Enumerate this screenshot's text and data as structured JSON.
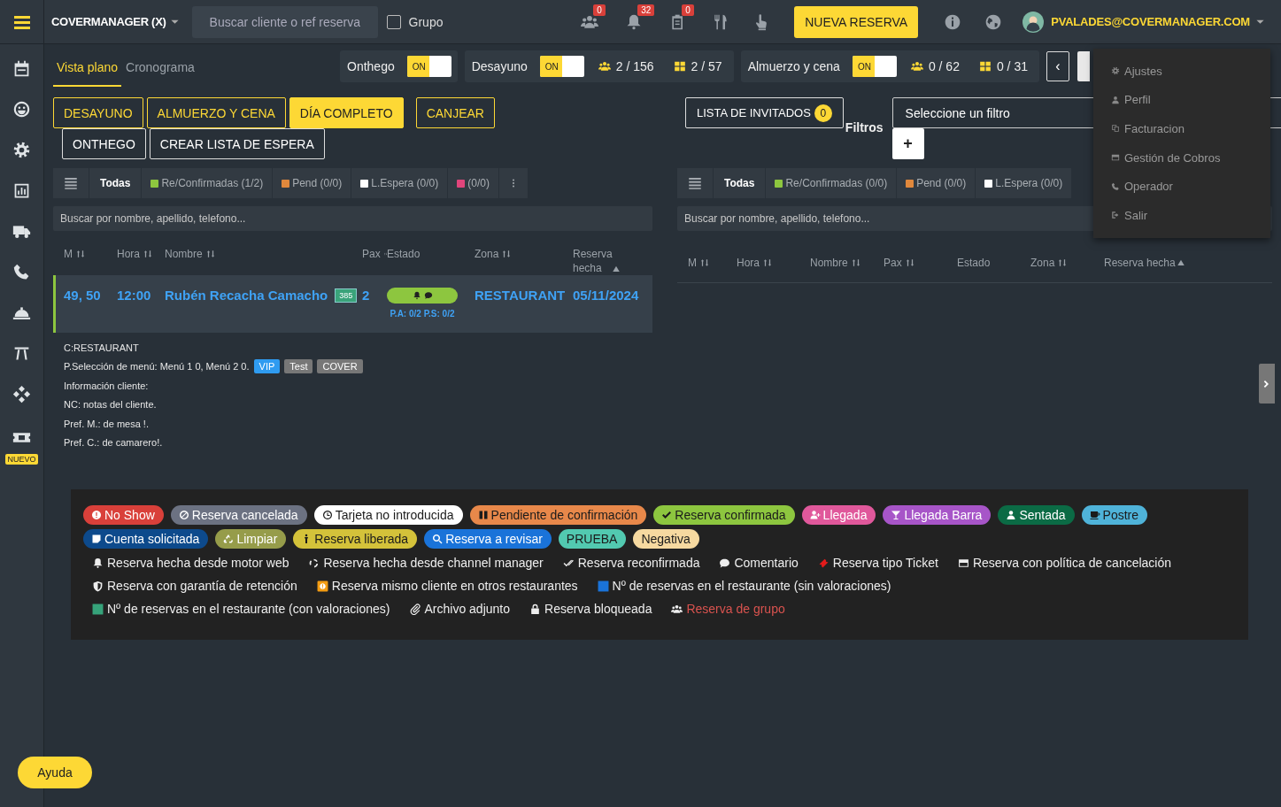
{
  "topbar": {
    "brand": "COVERMANAGER (X)",
    "search": {
      "placeholder": "Buscar cliente o ref reserva"
    },
    "group": {
      "label": "Grupo",
      "checked": false
    },
    "notifications": [
      {
        "count": "0"
      },
      {
        "count": "32"
      },
      {
        "count": "0"
      }
    ],
    "new_button": "NUEVA RESERVA",
    "user": "PVALADES@COVERMANAGER.COM"
  },
  "sidebar": {
    "badge": "NUEVO"
  },
  "view_tabs": [
    {
      "label": "Vista plano",
      "selected": true
    },
    {
      "label": "Cronograma",
      "selected": false
    }
  ],
  "services": [
    {
      "name": "Onthego",
      "toggle": "ON",
      "on": true
    },
    {
      "name": "Desayuno",
      "toggle": "ON",
      "on": true,
      "covers": "2 / 156",
      "tables": "2 / 57"
    },
    {
      "name": "Almuerzo y cena",
      "toggle": "ON",
      "on": true,
      "covers": "0 / 62",
      "tables": "0 / 31"
    }
  ],
  "prev_button": "‹",
  "left_panel": {
    "buttons": [
      {
        "label": "DESAYUNO",
        "kind": "shift",
        "selected": false
      },
      {
        "label": "ALMUERZO Y CENA",
        "kind": "shift",
        "selected": false
      },
      {
        "label": "DÍA COMPLETO",
        "kind": "shift",
        "selected": true
      },
      {
        "label": "CANJEAR",
        "kind": "shift",
        "selected": false
      },
      {
        "label": "ONTHEGO",
        "kind": "action",
        "selected": false
      },
      {
        "label": "CREAR LISTA DE ESPERA",
        "kind": "action",
        "selected": false
      }
    ],
    "status_filters": [
      {
        "label": "Todas",
        "selected": true
      },
      {
        "label": "Re/Confirmadas (1/2)",
        "color": "#8dc63f",
        "selected": false
      },
      {
        "label": "Pend (0/0)",
        "color": "#e0883c",
        "selected": false
      },
      {
        "label": "L.Espera (0/0)",
        "color": "#ffffff",
        "selected": false
      },
      {
        "label": "(0/0)",
        "color": "#e0457b",
        "selected": false
      }
    ],
    "search": {
      "placeholder": "Buscar por nombre, apellido, telefono..."
    },
    "columns": [
      {
        "label": "M",
        "sortable": true,
        "sorted": false
      },
      {
        "label": "Hora",
        "sortable": true,
        "sorted": false
      },
      {
        "label": "Nombre",
        "sortable": true,
        "sorted": false
      },
      {
        "label": "Pax",
        "sortable": true,
        "sorted": false
      },
      {
        "label": "Estado",
        "sortable": false,
        "sorted": false
      },
      {
        "label": "Zona",
        "sortable": true,
        "sorted": false
      },
      {
        "label": "Reserva hecha",
        "sortable": false,
        "sorted": true
      }
    ],
    "rows": [
      {
        "m": "49, 50",
        "hora": "12:00",
        "nombre": "Rubén Recacha Camacho",
        "visits": "385",
        "pax": "2",
        "color": "#8dc63f",
        "sub": "P.A: 0/2 P.S: 0/2",
        "zona": "RESTAURANT",
        "fecha": "05/11/2024"
      }
    ],
    "details": [
      {
        "text": "C:RESTAURANT"
      },
      {
        "text": "P.Selección de menú: Menú 1 0, Menú 2 0.",
        "tags": [
          {
            "label": "VIP",
            "color": "#2f9bf0"
          },
          {
            "label": "Test",
            "color": "#777777"
          },
          {
            "label": "COVER",
            "color": "#777777"
          }
        ]
      },
      {
        "text": "Información cliente:"
      },
      {
        "text": "NC: notas del cliente."
      },
      {
        "text": "Pref. M.: de mesa !."
      },
      {
        "text": "Pref. C.: de camarero!."
      }
    ]
  },
  "right_panel": {
    "guest_list": {
      "label": "LISTA DE INVITADOS",
      "count": "0"
    },
    "filters_label": "Filtros",
    "filter_select": {
      "placeholder": "Seleccione un filtro"
    },
    "add_button": "+",
    "status_filters": [
      {
        "label": "Todas",
        "selected": true
      },
      {
        "label": "Re/Confirmadas (0/0)",
        "color": "#8dc63f",
        "selected": false
      },
      {
        "label": "Pend (0/0)",
        "color": "#e0883c",
        "selected": false
      },
      {
        "label": "L.Espera (0/0)",
        "color": "#ffffff",
        "selected": false
      }
    ],
    "search": {
      "placeholder": "Buscar por nombre, apellido, telefono..."
    },
    "columns": [
      {
        "label": "M",
        "sortable": true,
        "sorted": false
      },
      {
        "label": "Hora",
        "sortable": true,
        "sorted": false
      },
      {
        "label": "Nombre",
        "sortable": true,
        "sorted": false
      },
      {
        "label": "Pax",
        "sortable": true,
        "sorted": false
      },
      {
        "label": "Estado",
        "sortable": false,
        "sorted": false
      },
      {
        "label": "Zona",
        "sortable": true,
        "sorted": false
      },
      {
        "label": "Reserva hecha",
        "sortable": false,
        "sorted": true
      }
    ]
  },
  "user_menu": [
    "Ajustes",
    "Perfil",
    "Facturacion",
    "Gestión de Cobros",
    "Operador",
    "Salir"
  ],
  "legend": {
    "pills": [
      {
        "label": "No Show",
        "color": "#d9403a"
      },
      {
        "label": "Reserva cancelada",
        "color": "#6c7282"
      },
      {
        "label": "Tarjeta no introducida",
        "color": "#ffffff"
      },
      {
        "label": "Pendiente de confirmación",
        "color": "#e8884a"
      },
      {
        "label": "Reserva confirmada",
        "color": "#8dc63f"
      },
      {
        "label": "Llegada",
        "color": "#e0589b"
      },
      {
        "label": "Llegada Barra",
        "color": "#a755c8"
      },
      {
        "label": "Sentada",
        "color": "#0b6b45"
      },
      {
        "label": "Postre",
        "color": "#4fb3d9"
      },
      {
        "label": "Cuenta solicitada",
        "color": "#0d4a8c"
      },
      {
        "label": "Limpiar",
        "color": "#969c4a"
      },
      {
        "label": "Reserva liberada",
        "color": "#d4c23a"
      },
      {
        "label": "Reserva a revisar",
        "color": "#1a73d9"
      },
      {
        "label": "PRUEBA",
        "color": "#52c9b0"
      },
      {
        "label": "Negativa",
        "color": "#f6d9a0"
      }
    ],
    "items": [
      {
        "label": "Reserva hecha desde motor web"
      },
      {
        "label": "Reserva hecha desde channel manager"
      },
      {
        "label": "Reserva reconfirmada"
      },
      {
        "label": "Comentario"
      },
      {
        "label": "Reserva tipo Ticket"
      },
      {
        "label": "Reserva con política de cancelación"
      },
      {
        "label": "Reserva con garantía de retención"
      },
      {
        "label": "Reserva mismo cliente en otros restaurantes"
      },
      {
        "label": "Nº de reservas en el restaurante (sin valoraciones)"
      },
      {
        "label": "Nº de reservas en el restaurante (con valoraciones)"
      },
      {
        "label": "Archivo adjunto"
      },
      {
        "label": "Reserva bloqueada"
      },
      {
        "label": "Reserva de grupo",
        "color": "#d9534f"
      }
    ]
  },
  "help_button": "Ayuda"
}
